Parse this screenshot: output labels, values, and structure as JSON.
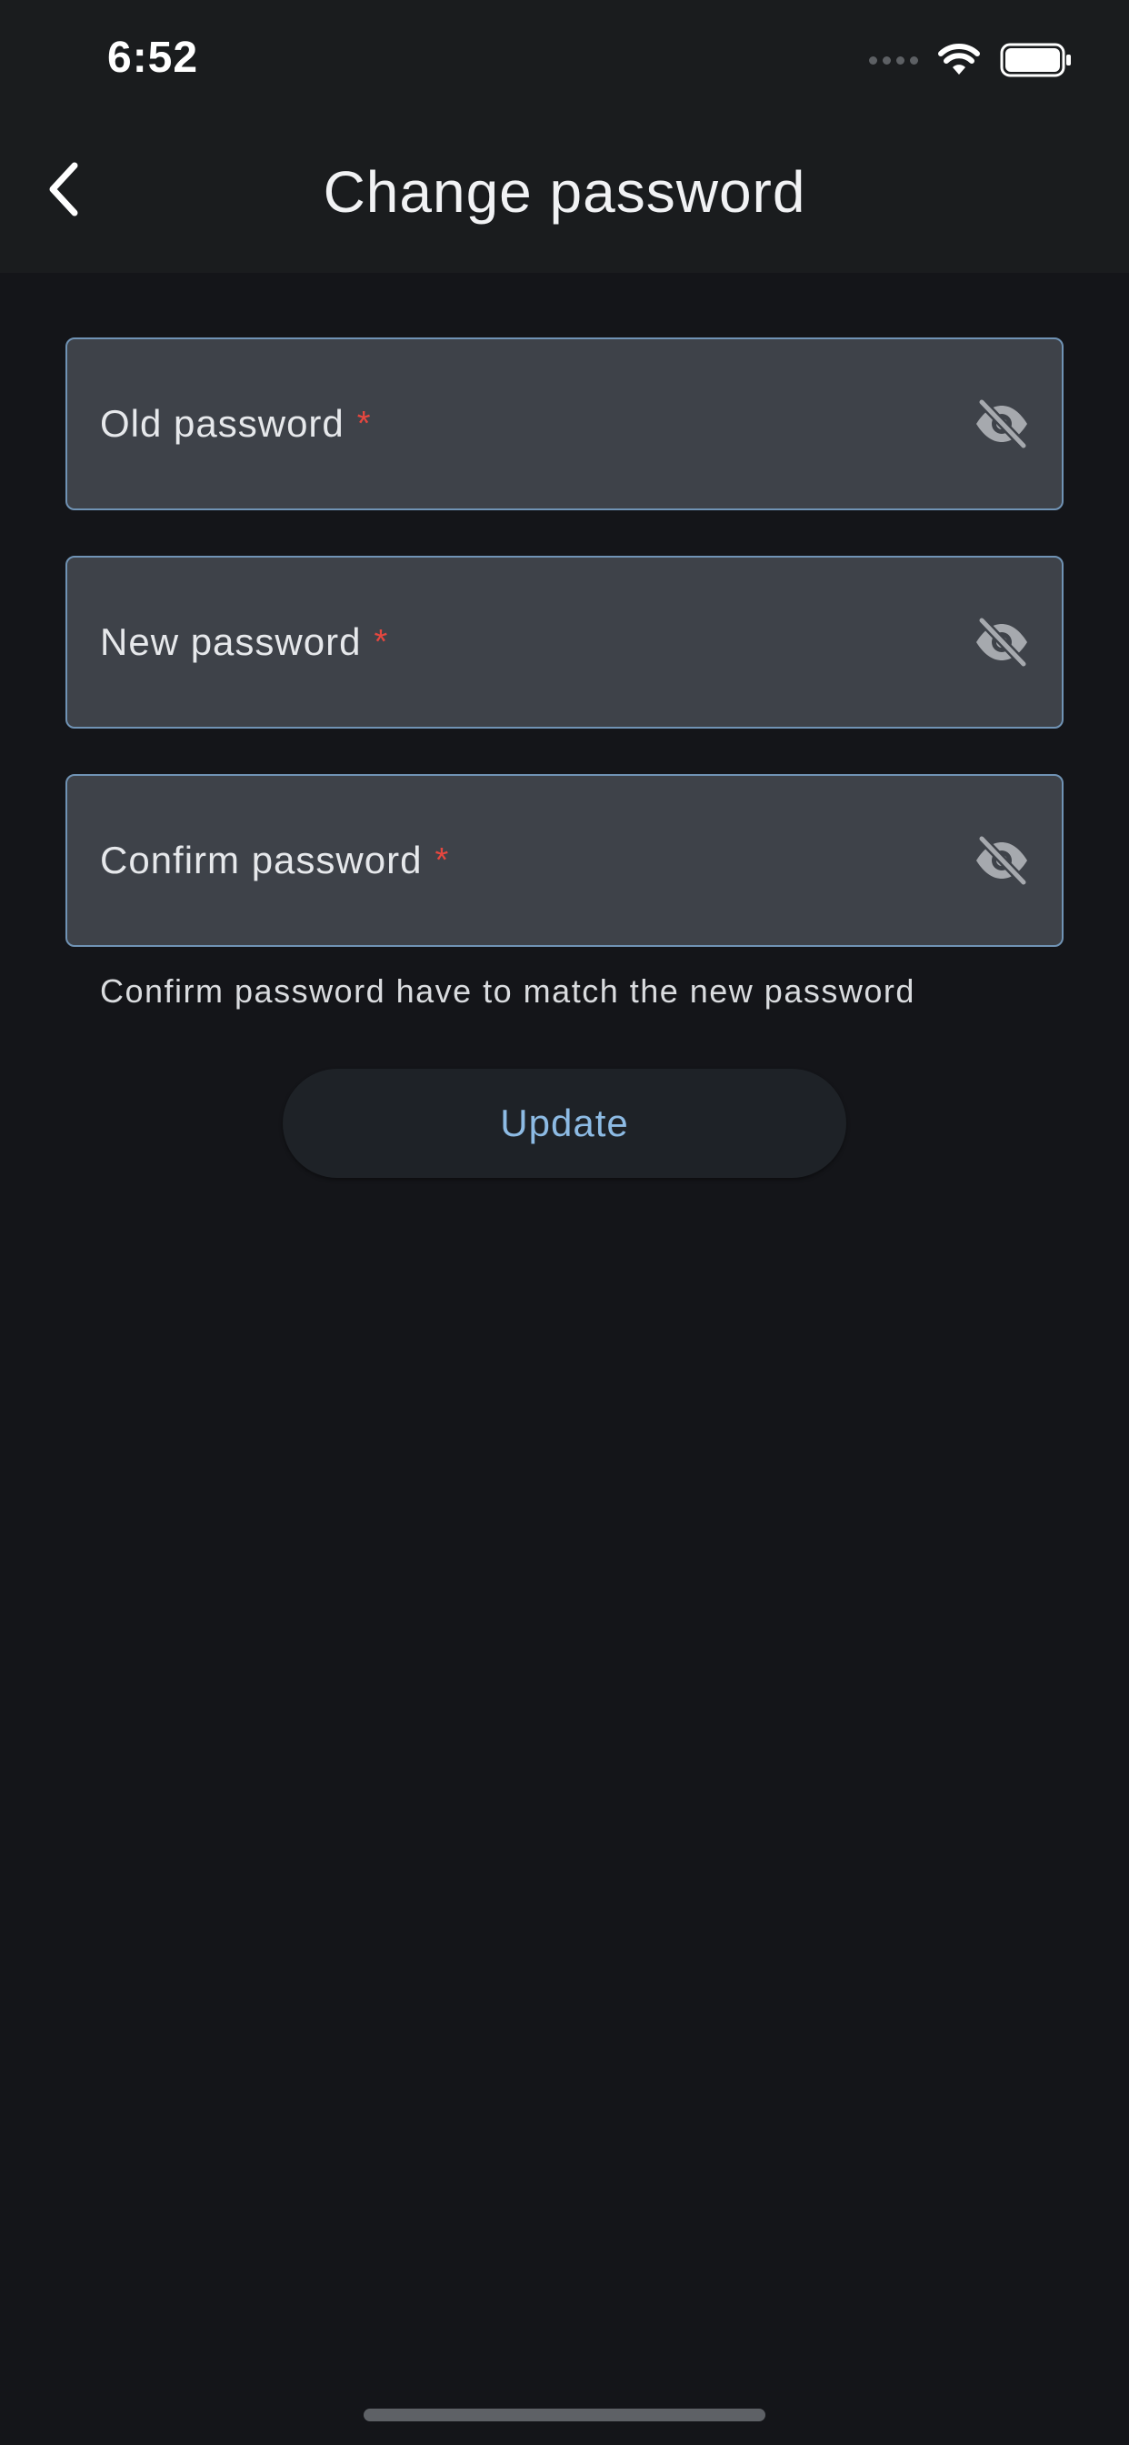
{
  "status_bar": {
    "time": "6:52",
    "icons": [
      "signal-icon",
      "wifi-icon",
      "battery-icon"
    ]
  },
  "nav": {
    "back_icon": "chevron-left-icon",
    "title": "Change password"
  },
  "form": {
    "fields": [
      {
        "label": "Old password",
        "required_mark": "*",
        "toggle_icon": "eye-off-icon"
      },
      {
        "label": "New password",
        "required_mark": "*",
        "toggle_icon": "eye-off-icon"
      },
      {
        "label": "Confirm password",
        "required_mark": "*",
        "toggle_icon": "eye-off-icon"
      }
    ],
    "helper_text": "Confirm password have to match the new password",
    "submit_label": "Update"
  },
  "colors": {
    "background": "#141519",
    "bar_background": "#1A1C1E",
    "field_background": "#3E4249",
    "field_border": "#7093B5",
    "required": "#E5473F",
    "accent": "#8DBBE4"
  }
}
